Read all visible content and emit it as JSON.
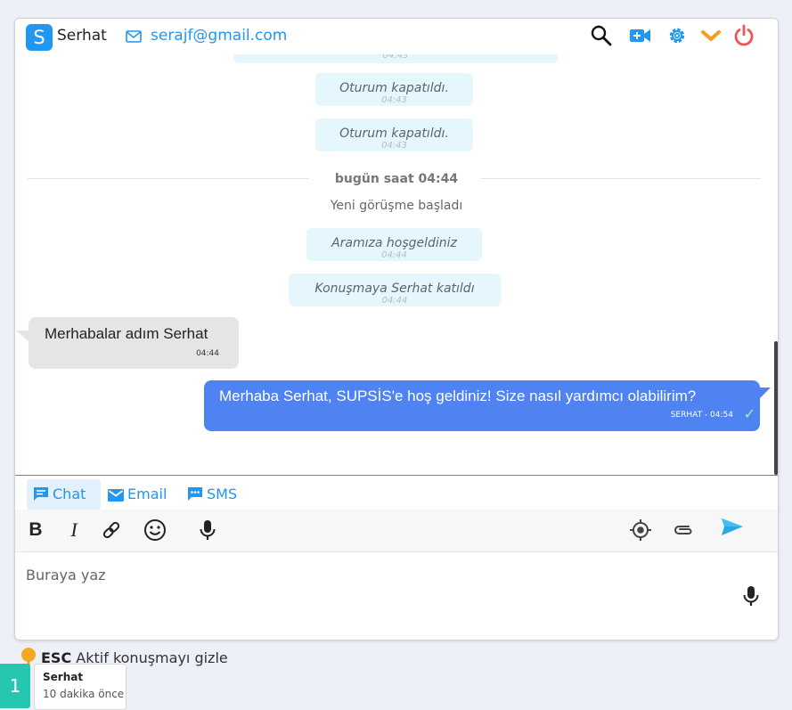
{
  "header": {
    "avatar_letter": "S",
    "contact_name": "Serhat",
    "contact_email": "serajf@gmail.com",
    "icons": [
      "search-icon",
      "video-add-icon",
      "gear-icon",
      "chevron-down-icon",
      "power-icon"
    ]
  },
  "messages": {
    "system_time_partial": "04:43",
    "early_system": [
      {
        "text": "Oturum kapatıldı.",
        "time": "04:43"
      },
      {
        "text": "Oturum kapatıldı.",
        "time": "04:43"
      }
    ],
    "date_separator": "bugün saat 04:44",
    "new_conversation": "Yeni görüşme başladı",
    "late_system": [
      {
        "text": "Aramıza hoşgeldiniz",
        "time": "04:44"
      },
      {
        "text": "Konuşmaya Serhat katıldı",
        "time": "04:44"
      }
    ],
    "incoming": {
      "text": "Merhabalar adım Serhat",
      "time": "04:44"
    },
    "outgoing": {
      "text": "Merhaba Serhat, SUPSİS'e hoş geldiniz! Size nasıl yardımcı olabilirim?",
      "meta": "SERHAT - 04:54",
      "check": "✓"
    }
  },
  "channels": {
    "chat": "Chat",
    "email": "Email",
    "sms": "SMS",
    "active": "chat"
  },
  "toolbar": {
    "bold": "B",
    "italic": "I",
    "icons": [
      "link-icon",
      "emoji-icon",
      "microphone-icon",
      "location-icon",
      "attachment-icon",
      "send-icon"
    ]
  },
  "input": {
    "placeholder": "Buraya yaz"
  },
  "footer": {
    "esc_key": "ESC",
    "esc_text": "Aktif konuşmayı gizle",
    "badge_count": "1",
    "conv_name": "Serhat",
    "conv_time": "10 dakika önce"
  },
  "colors": {
    "accent": "#2196f3",
    "outgoing_bubble": "#4e83f1",
    "incoming_bubble": "#e5e5e5",
    "system_bubble": "#e6f6fd",
    "power": "#f05454",
    "chevron": "#f59e1c",
    "badge": "#26c6b0"
  }
}
